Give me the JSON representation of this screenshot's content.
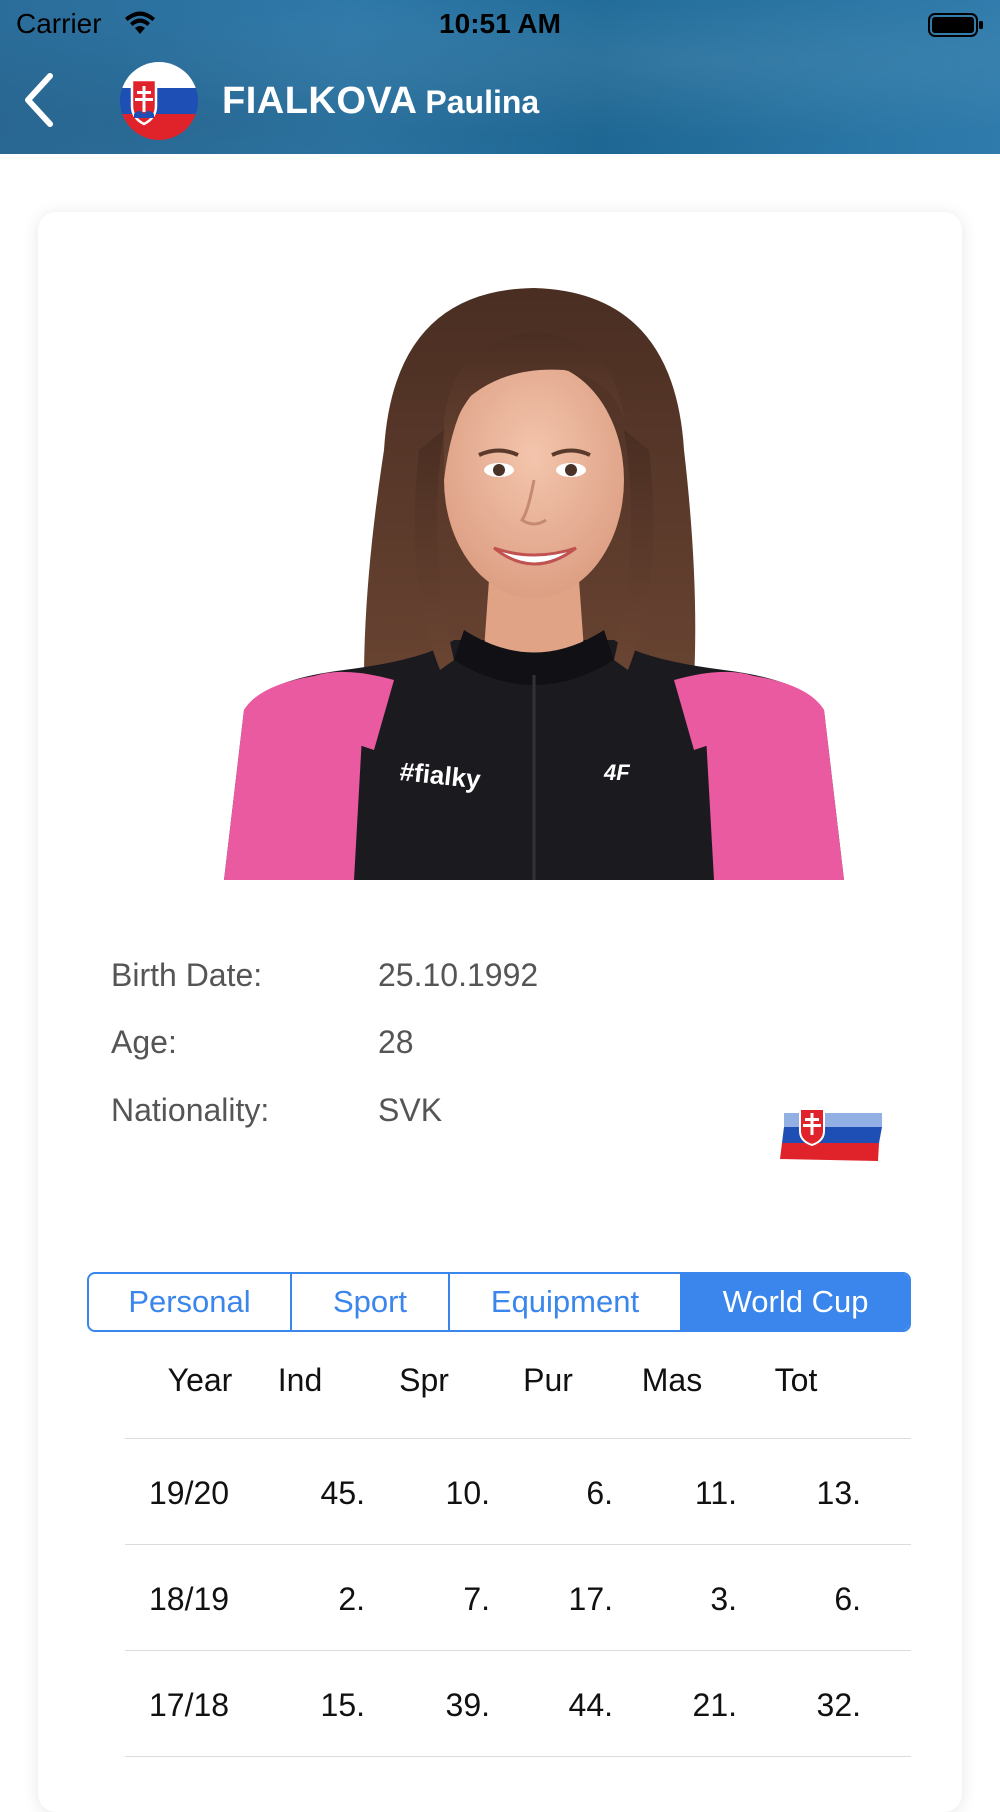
{
  "status_bar": {
    "carrier": "Carrier",
    "time": "10:51 AM"
  },
  "header": {
    "last_name": "FIALKOVA",
    "first_name": "Paulina",
    "back_icon": "chevron-left-icon",
    "flag_icon": "slovakia-flag-icon"
  },
  "athlete": {
    "photo": "athlete-portrait",
    "details": [
      {
        "label": "Birth Date:",
        "value": "25.10.1992"
      },
      {
        "label": "Age:",
        "value": "28"
      },
      {
        "label": "Nationality:",
        "value": "SVK"
      }
    ]
  },
  "tabs": [
    {
      "label": "Personal",
      "active": false
    },
    {
      "label": "Sport",
      "active": false
    },
    {
      "label": "Equipment",
      "active": false
    },
    {
      "label": "World Cup",
      "active": true
    }
  ],
  "world_cup_table": {
    "columns": [
      "Year",
      "Ind",
      "Spr",
      "Pur",
      "Mas",
      "Tot"
    ],
    "rows": [
      [
        "19/20",
        "45.",
        "10.",
        "6.",
        "11.",
        "13."
      ],
      [
        "18/19",
        "2.",
        "7.",
        "17.",
        "3.",
        "6."
      ],
      [
        "17/18",
        "15.",
        "39.",
        "44.",
        "21.",
        "32."
      ]
    ]
  },
  "colors": {
    "header_blue": "#2b6d9a",
    "accent_blue": "#3a86ec",
    "flag_white": "#ffffff",
    "flag_blue": "#1e4fb5",
    "flag_red": "#e0222a"
  }
}
